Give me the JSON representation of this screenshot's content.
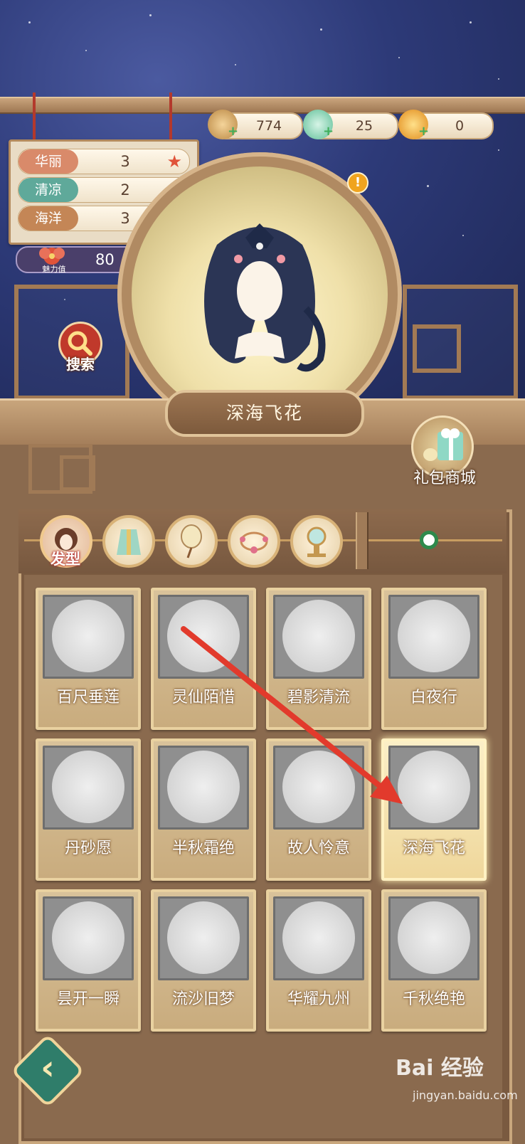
{
  "currencies": [
    {
      "name": "copper-coin",
      "value": "774",
      "color": "#d9a85a"
    },
    {
      "name": "jade-dragon",
      "value": "25",
      "color": "#7fd3b4"
    },
    {
      "name": "gold-feather",
      "value": "0",
      "color": "#f0a41f"
    }
  ],
  "attributes": [
    {
      "label": "华丽",
      "value": "3",
      "color": "#d98a6a"
    },
    {
      "label": "清凉",
      "value": "2",
      "color": "#5fa99a"
    },
    {
      "label": "海洋",
      "value": "3",
      "color": "#c48656"
    }
  ],
  "charm": {
    "label": "魅力值",
    "value": "80"
  },
  "search_label": "搜索",
  "current_item": "深海飞花",
  "gift_shop_label": "礼包商城",
  "tabs": [
    {
      "name": "hairstyle",
      "label": "发型",
      "active": true
    },
    {
      "name": "dress"
    },
    {
      "name": "fan"
    },
    {
      "name": "accessory"
    },
    {
      "name": "mirror"
    }
  ],
  "items": [
    {
      "name": "百尺垂莲"
    },
    {
      "name": "灵仙陌惜"
    },
    {
      "name": "碧影清流"
    },
    {
      "name": "白夜行"
    },
    {
      "name": "丹砂愿"
    },
    {
      "name": "半秋霜绝"
    },
    {
      "name": "故人怜意"
    },
    {
      "name": "深海飞花",
      "selected": true
    },
    {
      "name": "昙开一瞬"
    },
    {
      "name": "流沙旧梦"
    },
    {
      "name": "华耀九州"
    },
    {
      "name": "千秋绝艳"
    }
  ],
  "watermark": {
    "text": "Bai 经验",
    "url": "jingyan.baidu.com"
  },
  "colors": {
    "accent_red": "#e0533a",
    "selected_glow": "#fff0b4",
    "panel": "#7a5a40"
  }
}
